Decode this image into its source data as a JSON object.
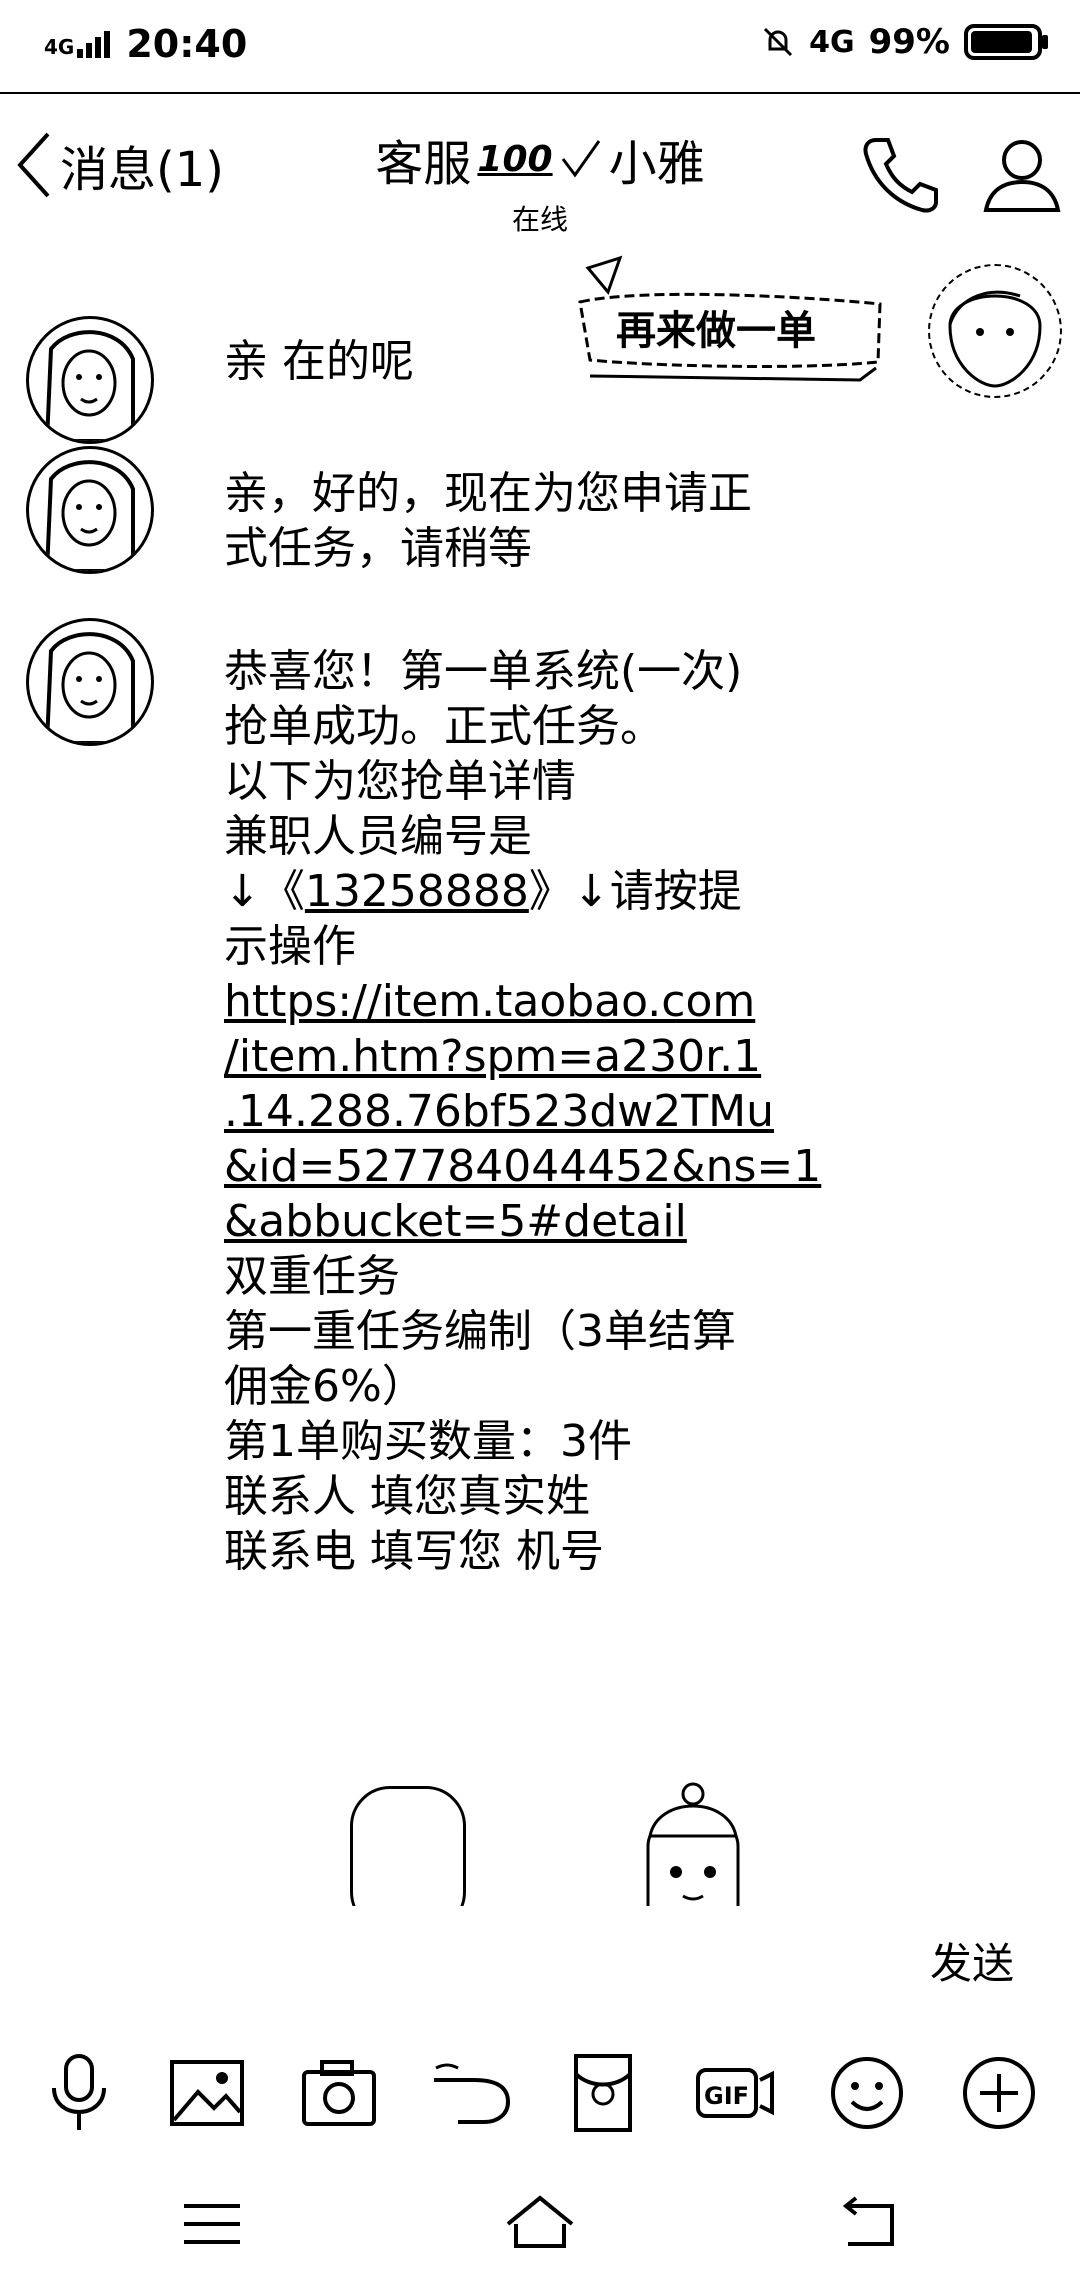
{
  "status_bar": {
    "network_left": "4G",
    "time": "20:40",
    "network_right": "4G",
    "battery_text": "99%",
    "battery_level": 0.99
  },
  "header": {
    "back_label": "消息(1)",
    "contact_prefix": "客服",
    "contact_badge": "100",
    "contact_suffix": "小雅",
    "status": "在线"
  },
  "chat": {
    "sent_sticker_text": "再来做一单",
    "messages": [
      {
        "lines": [
          "亲 在的呢"
        ]
      },
      {
        "lines": [
          "亲，好的，现在为您申请正",
          "式任务，请稍等"
        ]
      },
      {
        "lines": [
          "恭喜您！第一单系统(一次)",
          "抢单成功。正式任务。",
          "以下为您抢单详情",
          "兼职人员编号是"
        ],
        "id_prefix": "↓《",
        "id_number": "13258888",
        "id_suffix": "》↓请按提",
        "after_id": "示操作",
        "url_lines": [
          "https://item.taobao.com",
          "/item.htm?spm=a230r.1",
          ".14.288.76bf523dw2TMu",
          "&id=527784044452&ns=1",
          "&abbucket=5#detail"
        ],
        "tail_lines": [
          "双重任务",
          "第一重任务编制（3单结算",
          "佣金6%）",
          "第1单购买数量：3件",
          "联系人    填您真实姓",
          "联系电    填写您      机号"
        ]
      }
    ]
  },
  "input": {
    "send_label": "发送"
  },
  "toolbar_icons": [
    "microphone-icon",
    "image-icon",
    "camera-icon",
    "poke-icon",
    "red-packet-icon",
    "gif-icon",
    "emoji-icon",
    "plus-icon"
  ],
  "nav_icons": [
    "menu-icon",
    "home-icon",
    "back-icon"
  ]
}
